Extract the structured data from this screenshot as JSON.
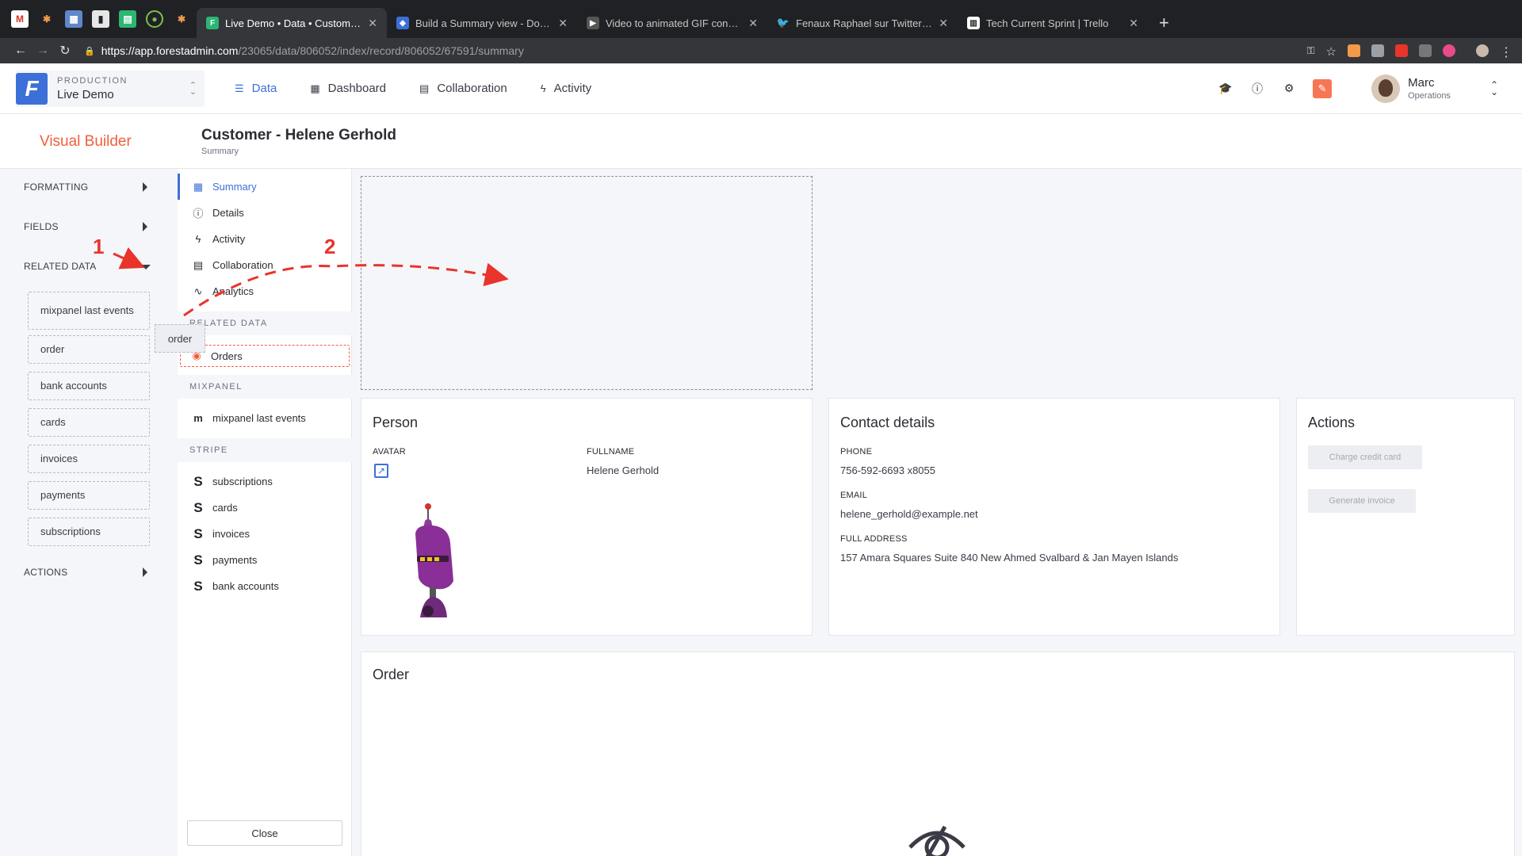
{
  "browser": {
    "tabs": [
      {
        "title": "Live Demo • Data • Customers",
        "active": true,
        "icon_color": "#2bb673"
      },
      {
        "title": "Build a Summary view - Docum",
        "active": false,
        "icon_color": "#3d6fd8"
      },
      {
        "title": "Video to animated GIF convert",
        "active": false,
        "icon_color": "#555555"
      },
      {
        "title": "Fenaux Raphael sur Twitter : \"",
        "active": false,
        "icon_color": "#1da1f2"
      },
      {
        "title": "Tech Current Sprint | Trello",
        "active": false,
        "icon_color": "#ffffff"
      }
    ],
    "url_host": "https://app.forestadmin.com",
    "url_path": "/23065/data/806052/index/record/806052/67591/summary",
    "new_tab": "+"
  },
  "header": {
    "project_env": "PRODUCTION",
    "project_name": "Live Demo",
    "logo_letter": "F",
    "nav": [
      {
        "label": "Data",
        "icon": "list-icon",
        "active": true
      },
      {
        "label": "Dashboard",
        "icon": "dashboard-icon",
        "active": false
      },
      {
        "label": "Collaboration",
        "icon": "chat-icon",
        "active": false
      },
      {
        "label": "Activity",
        "icon": "bolt-icon",
        "active": false
      }
    ],
    "user_name": "Marc",
    "user_role": "Operations",
    "accent": "#3d6fd8",
    "brand_orange": "#f77755"
  },
  "record": {
    "builder_title": "Visual Builder",
    "title": "Customer - Helene Gerhold",
    "subtitle": "Summary"
  },
  "builder": {
    "formatting": "FORMATTING",
    "fields": "FIELDS",
    "related_data": "RELATED DATA",
    "actions": "ACTIONS",
    "chips": [
      "mixpanel last events",
      "order",
      "bank accounts",
      "cards",
      "invoices",
      "payments",
      "subscriptions"
    ],
    "dragging_chip": "order"
  },
  "sections": {
    "items": [
      {
        "label": "Summary",
        "icon": "grid-icon",
        "active": true
      },
      {
        "label": "Details",
        "icon": "info-icon",
        "active": false
      },
      {
        "label": "Activity",
        "icon": "bolt-icon",
        "active": false
      },
      {
        "label": "Collaboration",
        "icon": "chat-icon",
        "active": false
      },
      {
        "label": "Analytics",
        "icon": "chart-icon",
        "active": false
      }
    ],
    "related_head": "RELATED DATA",
    "orders": "Orders",
    "mixpanel_head": "MIXPANEL",
    "mixpanel_item": "mixpanel last events",
    "stripe_head": "STRIPE",
    "stripe_items": [
      "subscriptions",
      "cards",
      "invoices",
      "payments",
      "bank accounts"
    ],
    "close": "Close"
  },
  "person": {
    "title": "Person",
    "avatar_label": "AVATAR",
    "fullname_label": "FULLNAME",
    "fullname": "Helene Gerhold"
  },
  "contact": {
    "title": "Contact details",
    "phone_label": "PHONE",
    "phone": "756-592-6693 x8055",
    "email_label": "EMAIL",
    "email": "helene_gerhold@example.net",
    "address_label": "FULL ADDRESS",
    "address": "157 Amara Squares Suite 840 New Ahmed Svalbard & Jan Mayen Islands"
  },
  "actions": {
    "title": "Actions",
    "charge": "Charge credit card",
    "invoice": "Generate invoice"
  },
  "order": {
    "title": "Order"
  },
  "annotations": {
    "step1": "1",
    "step2": "2",
    "color": "#e8342b"
  }
}
